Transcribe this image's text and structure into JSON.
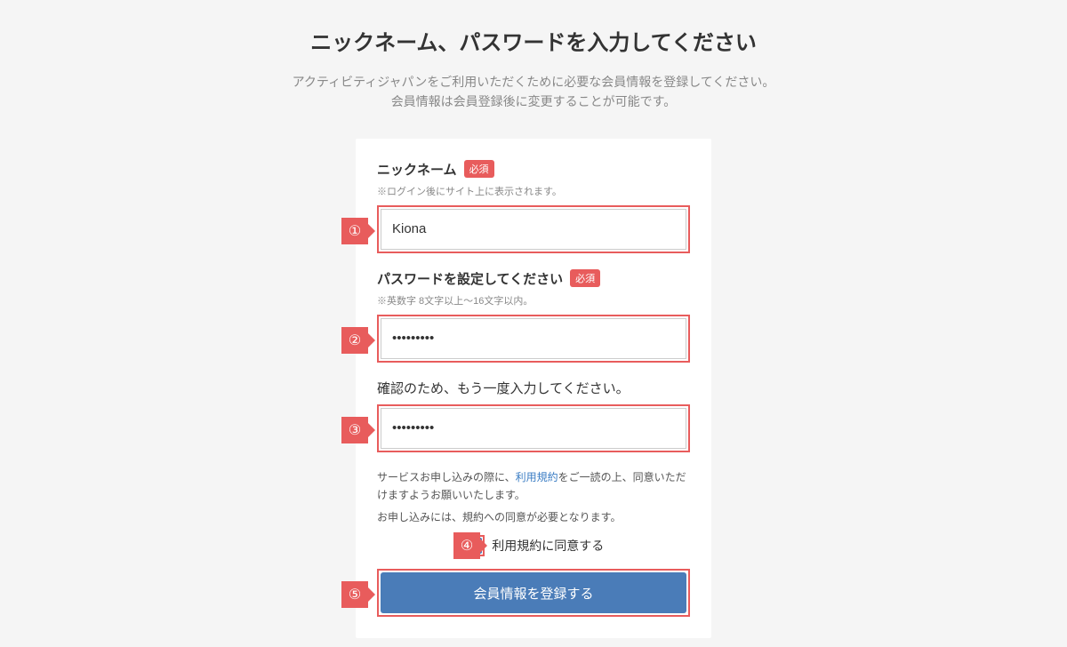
{
  "page": {
    "title": "ニックネーム、パスワードを入力してください",
    "subtitle_line1": "アクティビティジャパンをご利用いただくために必要な会員情報を登録してください。",
    "subtitle_line2": "会員情報は会員登録後に変更することが可能です。"
  },
  "markers": {
    "m1": "①",
    "m2": "②",
    "m3": "③",
    "m4": "④",
    "m5": "⑤"
  },
  "form": {
    "nickname": {
      "label": "ニックネーム",
      "required_badge": "必須",
      "hint": "※ログイン後にサイト上に表示されます。",
      "value": "Kiona"
    },
    "password": {
      "label": "パスワードを設定してください",
      "required_badge": "必須",
      "hint": "※英数字 8文字以上〜16文字以内。",
      "value": "•••••••••"
    },
    "password_confirm": {
      "label": "確認のため、もう一度入力してください。",
      "value": "•••••••••"
    },
    "terms": {
      "text_before": "サービスお申し込みの際に、",
      "link_text": "利用規約",
      "text_after": "をご一読の上、同意いただけますようお願いいたします。",
      "note": "お申し込みには、規約への同意が必要となります。",
      "agree_label": "利用規約に同意する",
      "checked": true
    },
    "submit_label": "会員情報を登録する"
  }
}
